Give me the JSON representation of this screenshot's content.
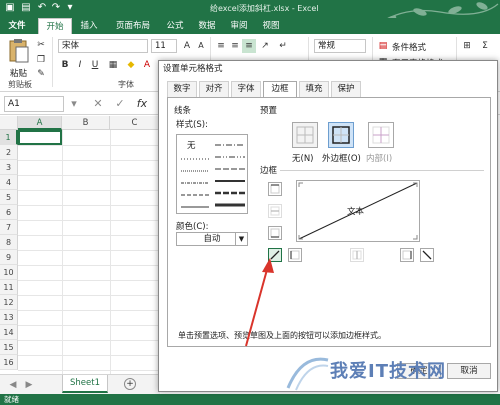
{
  "window": {
    "title": "给excel添加斜杠.xlsx - Excel"
  },
  "tabs": [
    "文件",
    "开始",
    "插入",
    "页面布局",
    "公式",
    "数据",
    "审阅",
    "视图"
  ],
  "ribbon": {
    "font_name": "宋体",
    "font_size": "11",
    "number_format": "常规",
    "cond_format": "条件格式",
    "table_format": "套用表格格式",
    "groups": {
      "clipboard": "剪贴板",
      "font": "字体"
    },
    "paste_label": "粘贴"
  },
  "formula_bar": {
    "name_box": "A1",
    "fx": "fx"
  },
  "grid": {
    "columns": [
      "A",
      "B",
      "C"
    ],
    "rows": [
      "1",
      "2",
      "3",
      "4",
      "5",
      "6",
      "7",
      "8",
      "9",
      "10",
      "11",
      "12",
      "13",
      "14",
      "15",
      "16"
    ]
  },
  "sheet": {
    "tab": "Sheet1",
    "status": "就绪"
  },
  "dialog": {
    "title": "设置单元格格式",
    "tabs": [
      "数字",
      "对齐",
      "字体",
      "边框",
      "填充",
      "保护"
    ],
    "active_tab": "边框",
    "line_group": "线条",
    "style_label": "样式(S):",
    "style_none": "无",
    "color_label": "颜色(C):",
    "color_value": "自动",
    "presets_label": "预置",
    "presets": [
      "无(N)",
      "外边框(O)",
      "内部(I)"
    ],
    "border_label": "边框",
    "preview_text": "文本",
    "hint": "单击预置选项、预览草图及上面的按钮可以添加边框样式。",
    "ok": "确定",
    "cancel": "取消"
  },
  "watermark": {
    "text": "我爱IT技术网"
  },
  "colors": {
    "excel_green": "#217346",
    "annotation_red": "#d9342b"
  }
}
